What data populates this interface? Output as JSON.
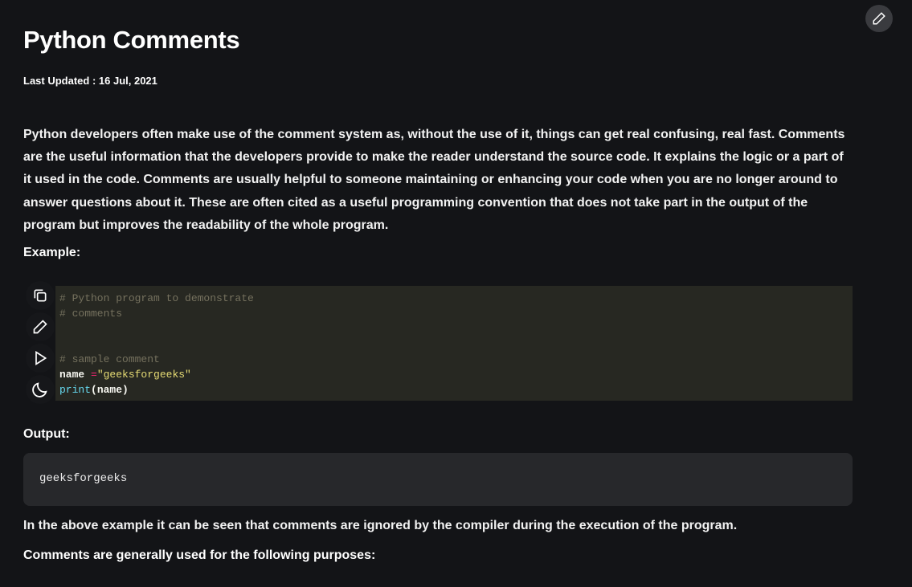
{
  "article": {
    "title": "Python Comments",
    "last_updated": "Last Updated : 16 Jul, 2021",
    "intro": "Python developers often make use of the comment system as, without the use of it, things can get real confusing, real fast. Comments are the useful information that the developers provide to make the reader understand the source code. It explains the logic or a part of it used in the code. Comments are usually helpful to someone maintaining or enhancing your code when you are no longer around to answer questions about it. These are often cited as a useful programming convention that does not take part in the output of the program but improves the readability of the whole program.",
    "example_heading": "Example:",
    "code": {
      "line1": "# Python program to demonstrate",
      "line2": "# comments",
      "line3": "# sample comment",
      "line4_name": "name ",
      "line4_op": "=",
      "line4_str": "\"geeksforgeeks\"",
      "line5_fn": "print",
      "line5_rest": "(name)"
    },
    "output_heading": "Output:",
    "output": "geeksforgeeks",
    "after_output": "In the above example it can be seen that comments are ignored by the compiler during the execution of the program.",
    "purposes_heading": "Comments are generally used for the following purposes:"
  },
  "icons": {
    "edit": "pencil-icon",
    "copy": "copy-icon",
    "run": "play-icon",
    "theme": "moon-icon"
  }
}
